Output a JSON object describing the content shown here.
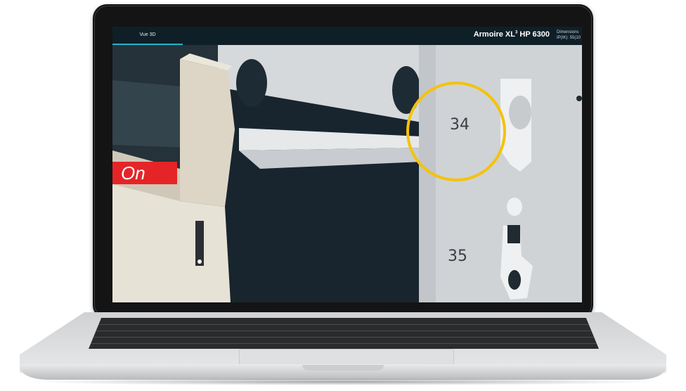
{
  "app": {
    "tab_label": "Vue 3D",
    "product_title_main": "Armoire XL",
    "product_title_sup": "3",
    "product_title_rest": " HP 6300",
    "dimensions_label": "Dimensions",
    "dimensions_value": "IP(IK): 55(10"
  },
  "scene": {
    "switch_state": "On",
    "rail_number_upper": "34",
    "rail_number_lower": "35",
    "highlight_color": "#f4c20d",
    "on_color": "#e52427"
  }
}
